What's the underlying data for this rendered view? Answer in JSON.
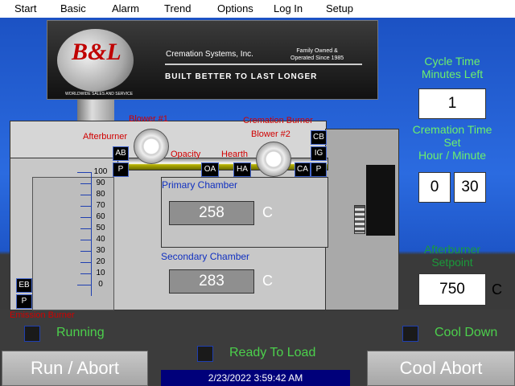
{
  "menu": [
    "Start",
    "Basic",
    "Alarm",
    "Trend",
    "Options",
    "Log In",
    "Setup"
  ],
  "logo": {
    "brand": "B&L",
    "worldwide": "WORLDWIDE SALES AND SERVICE",
    "company": "Cremation Systems, Inc.",
    "family_line1": "Family Owned &",
    "family_line2": "Operated Since 1985",
    "slogan": "BUILT BETTER TO LAST LONGER"
  },
  "labels": {
    "afterburner": "Afterburner",
    "blower1": "Blower #1",
    "cremation_burner": "Cremation Burner",
    "blower2": "Blower #2",
    "opacity": "Opacity",
    "hearth": "Hearth",
    "emission_burner": "Emission Burner",
    "primary_chamber": "Primary Chamber",
    "secondary_chamber": "Secondary Chamber"
  },
  "tags": {
    "ab": "AB",
    "p1": "P",
    "oa": "OA",
    "ha": "HA",
    "ca": "CA",
    "p2": "P",
    "cb": "CB",
    "ig": "IG",
    "eb": "EB",
    "p3": "P"
  },
  "scale": [
    "100",
    "90",
    "80",
    "70",
    "60",
    "50",
    "40",
    "30",
    "20",
    "10",
    "0"
  ],
  "primary": {
    "value": "258",
    "unit": "C"
  },
  "secondary": {
    "value": "283",
    "unit": "C"
  },
  "cycle_time": {
    "title_line1": "Cycle Time",
    "title_line2": "Minutes Left",
    "value": "1"
  },
  "cremation_time": {
    "title_line1": "Cremation Time",
    "title_line2": "Set",
    "title_line3": "Hour / Minute",
    "hour": "0",
    "minute": "30"
  },
  "afterburner_setpoint": {
    "title_line1": "Afterburner",
    "title_line2": "Setpoint",
    "value": "750",
    "unit": "C"
  },
  "status": {
    "running": "Running",
    "cool_down": "Cool Down",
    "ready": "Ready To Load"
  },
  "buttons": {
    "run_abort": "Run / Abort",
    "cool_abort": "Cool Abort"
  },
  "datetime": "2/23/2022 3:59:42 AM",
  "colors": {
    "status_green": "#4cd04c",
    "label_red": "#d00000",
    "label_blue": "#1030c0"
  }
}
